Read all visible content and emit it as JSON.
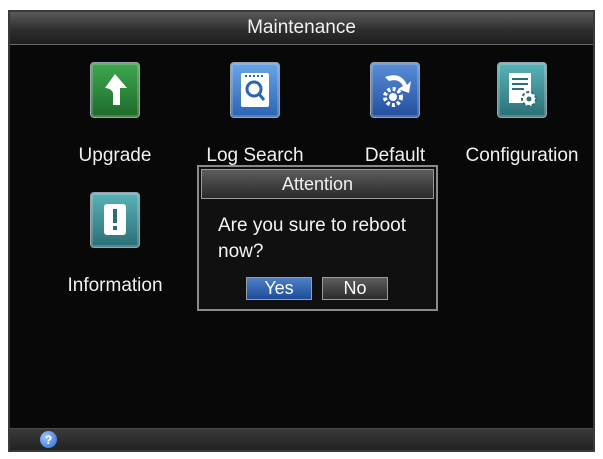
{
  "window": {
    "title": "Maintenance"
  },
  "menu_items": [
    {
      "label": "Upgrade",
      "icon": "upgrade-arrow-icon",
      "color": "#2e8a3e"
    },
    {
      "label": "Log Search",
      "icon": "log-search-icon",
      "color": "#3b7cc9"
    },
    {
      "label": "Default",
      "icon": "default-gear-icon",
      "color": "#3467b8"
    },
    {
      "label": "Configuration",
      "icon": "configuration-icon",
      "color": "#3f8f94"
    },
    {
      "label": "Information",
      "icon": "information-icon",
      "color": "#3f8f94"
    }
  ],
  "dialog": {
    "title": "Attention",
    "message": "Are you sure to reboot now?",
    "yes_label": "Yes",
    "no_label": "No"
  },
  "status_bar": {
    "help_icon": "help-icon",
    "help_glyph": "?"
  },
  "colors": {
    "background": "#080808",
    "accent": "#2e60b0"
  }
}
